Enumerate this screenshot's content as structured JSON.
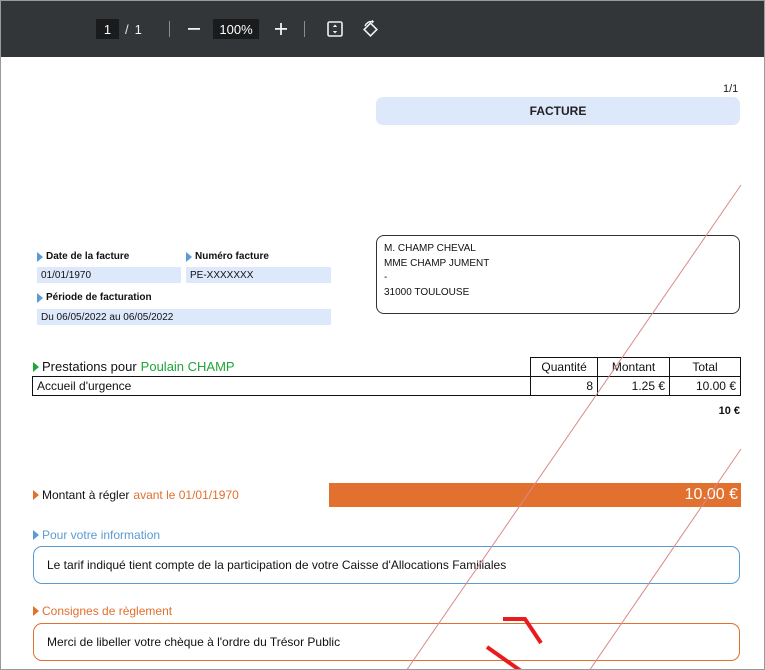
{
  "toolbar": {
    "current_page": "1",
    "page_separator": "/",
    "total_pages": "1",
    "zoom": "100%"
  },
  "invoice": {
    "page_indicator": "1/1",
    "title": "FACTURE",
    "date_label": "Date de la facture",
    "date_value": "01/01/1970",
    "number_label": "Numéro facture",
    "number_value": "PE-XXXXXXX",
    "period_label": "Période de facturation",
    "period_value": "Du 06/05/2022 au 06/05/2022",
    "address": {
      "line1": "M. CHAMP CHEVAL",
      "line2": "MME CHAMP JUMENT",
      "line3": "-",
      "line4": "31000 TOULOUSE"
    },
    "services_label": "Prestations pour",
    "services_child": "Poulain CHAMP",
    "table": {
      "headers": [
        "Quantité",
        "Montant",
        "Total"
      ],
      "rows": [
        {
          "label": "Accueil d'urgence",
          "qty": "8",
          "amount": "1.25 €",
          "total": "10.00 €"
        }
      ]
    },
    "subtotal": "10 €",
    "due_label": "Montant à régler",
    "due_date_text": "avant le 01/01/1970",
    "due_amount": "10.00 €",
    "info_label": "Pour votre information",
    "info_text": "Le tarif indiqué tient compte de la participation de votre Caisse d'Allocations Familiales",
    "payment_label": "Consignes de règlement",
    "payment_text": "Merci de libeller votre chèque à l'ordre du Trésor Public"
  },
  "colors": {
    "accent_blue": "#5b9bd5",
    "field_blue": "#dde8fb",
    "accent_orange": "#e2702e",
    "accent_green": "#1fa53a",
    "watermark_red": "#e81c1c",
    "toolbar_bg": "#323639"
  },
  "icons": [
    "minus-icon",
    "plus-icon",
    "fit-page-icon",
    "rotate-icon"
  ]
}
